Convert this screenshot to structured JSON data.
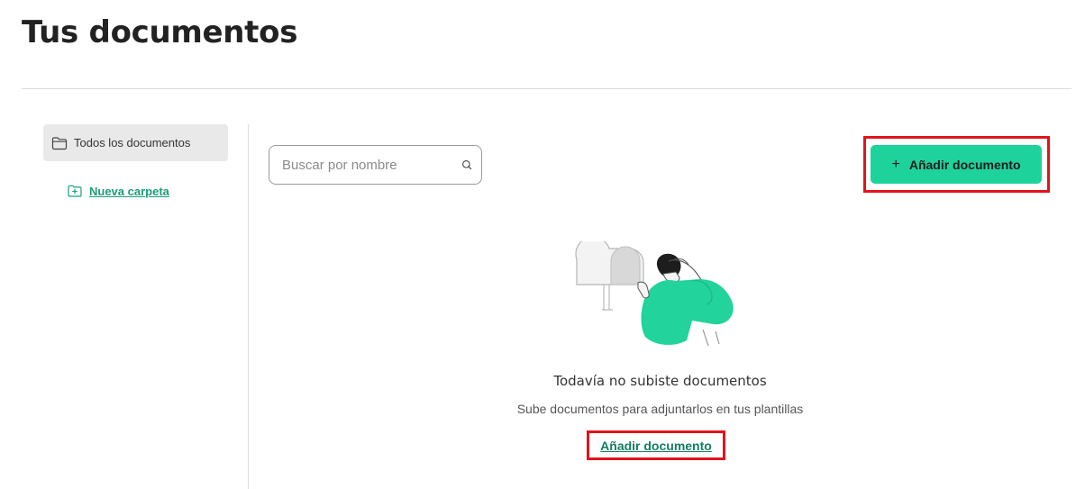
{
  "page": {
    "title": "Tus documentos"
  },
  "sidebar": {
    "all_documents": {
      "label": "Todos los documentos",
      "icon": "folder-icon"
    },
    "new_folder": {
      "label": "Nueva carpeta",
      "icon": "folder-plus-icon"
    }
  },
  "toolbar": {
    "search": {
      "placeholder": "Buscar por nombre",
      "value": "",
      "icon": "search-icon"
    },
    "add_button": {
      "plus": "+",
      "label": "Añadir documento"
    }
  },
  "empty_state": {
    "illustration": "person-with-mailbox-illustration",
    "title": "Todavía no subiste documentos",
    "subtitle": "Sube documentos para adjuntarlos en tus plantillas",
    "link": "Añadir documento"
  },
  "colors": {
    "accent": "#1ed39b",
    "link": "#1a9e79",
    "highlight": "#e3131b"
  }
}
